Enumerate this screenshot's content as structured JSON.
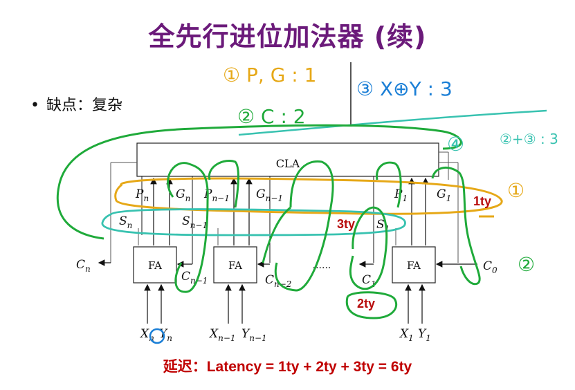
{
  "title": "全先行进位加法器 (续)",
  "bullet": "缺点：复杂",
  "footer": "延迟：Latency = 1ty + 2ty + 3ty = 6ty",
  "diagram": {
    "cla_label": "CLA",
    "fa_label": "FA",
    "ellipsis": "......",
    "signals": {
      "pn": "P",
      "pn_sub": "n",
      "gn": "G",
      "gn_sub": "n",
      "pn1": "P",
      "pn1_sub": "n−1",
      "gn1": "G",
      "gn1_sub": "n−1",
      "p1": "P",
      "p1_sub": "1",
      "g1": "G",
      "g1_sub": "1",
      "sn": "S",
      "sn_sub": "n",
      "sn1": "S",
      "sn1_sub": "n−1",
      "s1": "S",
      "s1_sub": "1",
      "cn": "C",
      "cn_sub": "n",
      "cn1": "C",
      "cn1_sub": "n−1",
      "cn2": "C",
      "cn2_sub": "n−2",
      "c1": "C",
      "c1_sub": "1",
      "c0": "C",
      "c0_sub": "0",
      "xn": "X",
      "xn_sub": "n",
      "yn": "Y",
      "yn_sub": "n",
      "xn1": "X",
      "xn1_sub": "n−1",
      "yn1": "Y",
      "yn1_sub": "n−1",
      "x1": "X",
      "x1_sub": "1",
      "y1": "Y",
      "y1_sub": "1"
    }
  },
  "annotations": {
    "step1": "① P, G : 1",
    "step2": "② C : 2",
    "step3": "③ X⊕Y : 3",
    "step4": "④",
    "step4_formula": "②+③ : 3",
    "mark1": "①",
    "mark2": "②",
    "delay1": "1ty",
    "delay2": "2ty",
    "delay3": "3ty"
  },
  "colors": {
    "title": "#6b1a7a",
    "red_label": "#b80c0c",
    "hand_yellow": "#e6a817",
    "hand_green": "#1faa3a",
    "hand_cyan": "#38c2b0",
    "hand_blue": "#1b7fd6"
  }
}
